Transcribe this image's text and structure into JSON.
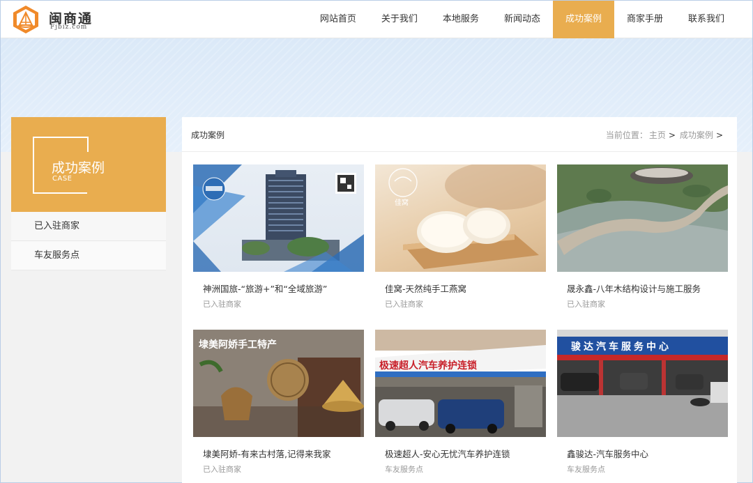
{
  "brand": {
    "name": "闽商通",
    "domain": "Fjbiz.com",
    "accent_color": "#e9ad4f"
  },
  "nav": {
    "items": [
      {
        "label": "网站首页"
      },
      {
        "label": "关于我们"
      },
      {
        "label": "本地服务"
      },
      {
        "label": "新闻动态"
      },
      {
        "label": "成功案例"
      },
      {
        "label": "商家手册"
      },
      {
        "label": "联系我们"
      }
    ],
    "active": "成功案例"
  },
  "sidebar": {
    "title": "成功案例",
    "subtitle": "CASE",
    "links": [
      {
        "label": "已入驻商家"
      },
      {
        "label": "车友服务点"
      }
    ]
  },
  "main": {
    "section_title": "成功案例",
    "breadcrumb": {
      "prefix": "当前位置：",
      "home": "主页",
      "current": "成功案例",
      "sep": ">"
    },
    "cases": [
      {
        "title": "神洲国旅-“旅游+”和“全域旅游”",
        "category": "已入驻商家",
        "image": "office-building-photo"
      },
      {
        "title": "佳窝-天然纯手工燕窝",
        "category": "已入驻商家",
        "image": "birds-nest-photo",
        "image_text": "佳窝"
      },
      {
        "title": "晟永鑫-八年木结构设计与施工服务",
        "category": "已入驻商家",
        "image": "landscape-architecture-photo"
      },
      {
        "title": "埭美阿娇-有来古村落,记得来我家",
        "category": "已入驻商家",
        "image": "handcraft-baskets-photo",
        "image_text": "埭美阿娇手工特产"
      },
      {
        "title": "极速超人-安心无忧汽车养护连锁",
        "category": "车友服务点",
        "image": "car-care-shop-photo",
        "image_text": "极速超人汽车养护连锁"
      },
      {
        "title": "鑫骏达-汽车服务中心",
        "category": "车友服务点",
        "image": "car-service-center-photo",
        "image_text": "骏达汽车服务中心"
      }
    ]
  }
}
